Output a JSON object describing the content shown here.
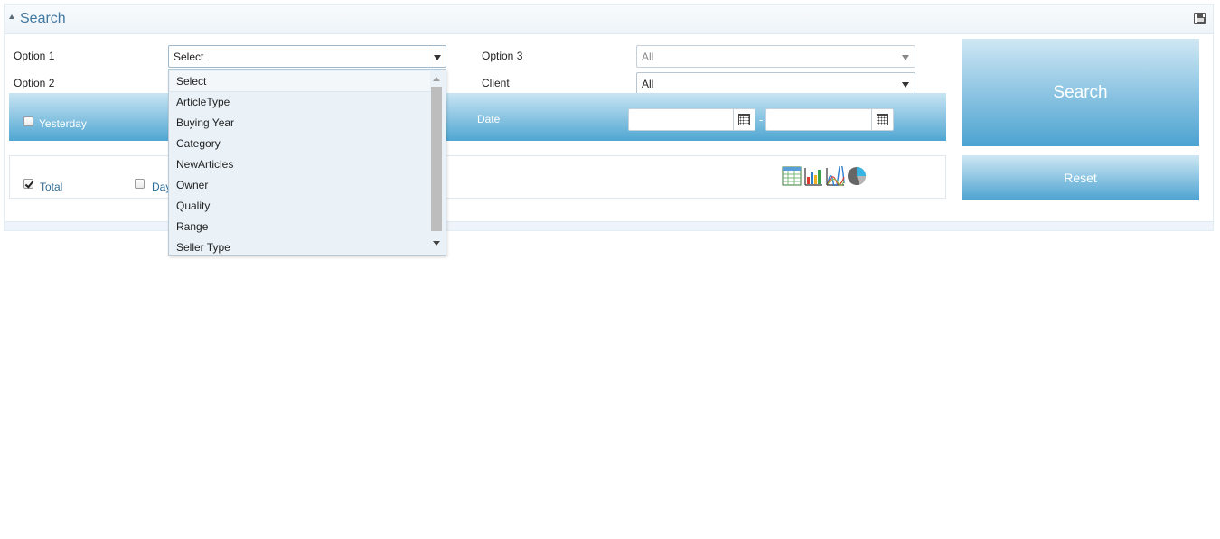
{
  "panel": {
    "title": "Search"
  },
  "form": {
    "option1": {
      "label": "Option 1",
      "value": "Select"
    },
    "option2": {
      "label": "Option 2"
    },
    "option3": {
      "label": "Option 3",
      "value": "All"
    },
    "client": {
      "label": "Client",
      "value": "All"
    },
    "yesterday": {
      "label": "Yesterday",
      "checked": false
    },
    "date": {
      "label": "Date",
      "from": "",
      "to": "",
      "separator": "-"
    },
    "total": {
      "label": "Total",
      "checked": true
    },
    "day": {
      "label": "Day",
      "checked": false
    }
  },
  "dropdown": {
    "items": [
      "Select",
      "ArticleType",
      "Buying Year",
      "Category",
      "NewArticles",
      "Owner",
      "Quality",
      "Range",
      "Seller Type"
    ],
    "selected_index": 0
  },
  "view_icons": [
    "table-view-icon",
    "bar-chart-icon",
    "line-chart-icon",
    "pie-chart-icon"
  ],
  "buttons": {
    "search": "Search",
    "reset": "Reset"
  },
  "colors": {
    "accent": "#4ca3d1",
    "title": "#3f79a3"
  }
}
